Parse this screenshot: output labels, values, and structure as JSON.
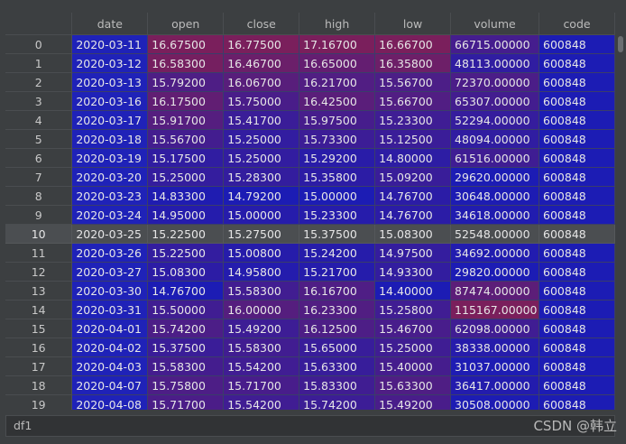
{
  "table": {
    "columns": [
      "",
      "date",
      "open",
      "close",
      "high",
      "low",
      "volume",
      "code"
    ],
    "rows": [
      [
        "0",
        "2020-03-11",
        "16.67500",
        "16.77500",
        "17.16700",
        "16.66700",
        "66715.00000",
        "600848"
      ],
      [
        "1",
        "2020-03-12",
        "16.58300",
        "16.46700",
        "16.65000",
        "16.35800",
        "48113.00000",
        "600848"
      ],
      [
        "2",
        "2020-03-13",
        "15.79200",
        "16.06700",
        "16.21700",
        "15.56700",
        "72370.00000",
        "600848"
      ],
      [
        "3",
        "2020-03-16",
        "16.17500",
        "15.75000",
        "16.42500",
        "15.66700",
        "65307.00000",
        "600848"
      ],
      [
        "4",
        "2020-03-17",
        "15.91700",
        "15.41700",
        "15.97500",
        "15.23300",
        "52294.00000",
        "600848"
      ],
      [
        "5",
        "2020-03-18",
        "15.56700",
        "15.25000",
        "15.73300",
        "15.12500",
        "48094.00000",
        "600848"
      ],
      [
        "6",
        "2020-03-19",
        "15.17500",
        "15.25000",
        "15.29200",
        "14.80000",
        "61516.00000",
        "600848"
      ],
      [
        "7",
        "2020-03-20",
        "15.25000",
        "15.28300",
        "15.35800",
        "15.09200",
        "29620.00000",
        "600848"
      ],
      [
        "8",
        "2020-03-23",
        "14.83300",
        "14.79200",
        "15.00000",
        "14.76700",
        "30648.00000",
        "600848"
      ],
      [
        "9",
        "2020-03-24",
        "14.95000",
        "15.00000",
        "15.23300",
        "14.76700",
        "34618.00000",
        "600848"
      ],
      [
        "10",
        "2020-03-25",
        "15.22500",
        "15.27500",
        "15.37500",
        "15.08300",
        "52548.00000",
        "600848"
      ],
      [
        "11",
        "2020-03-26",
        "15.22500",
        "15.00800",
        "15.24200",
        "14.97500",
        "34692.00000",
        "600848"
      ],
      [
        "12",
        "2020-03-27",
        "15.08300",
        "14.95800",
        "15.21700",
        "14.93300",
        "29820.00000",
        "600848"
      ],
      [
        "13",
        "2020-03-30",
        "14.76700",
        "15.58300",
        "16.16700",
        "14.40000",
        "87474.00000",
        "600848"
      ],
      [
        "14",
        "2020-03-31",
        "15.50000",
        "16.00000",
        "16.23300",
        "15.25800",
        "115167.00000",
        "600848"
      ],
      [
        "15",
        "2020-04-01",
        "15.74200",
        "15.49200",
        "16.12500",
        "15.46700",
        "62098.00000",
        "600848"
      ],
      [
        "16",
        "2020-04-02",
        "15.37500",
        "15.58300",
        "15.65000",
        "15.25000",
        "38338.00000",
        "600848"
      ],
      [
        "17",
        "2020-04-03",
        "15.58300",
        "15.54200",
        "15.63300",
        "15.40000",
        "31037.00000",
        "600848"
      ],
      [
        "18",
        "2020-04-07",
        "15.75800",
        "15.71700",
        "15.83300",
        "15.63300",
        "36417.00000",
        "600848"
      ],
      [
        "19",
        "2020-04-08",
        "15.71700",
        "15.54200",
        "15.74200",
        "15.49200",
        "30508.00000",
        "600848"
      ]
    ],
    "selected_row_index": 10,
    "colors": {
      "low": "#1c1cb4",
      "high": "#7a1f5c",
      "selected": "#4b4e51",
      "header_bg": "#3c3f41"
    }
  },
  "bottom": {
    "dataframe_name": "df1"
  },
  "watermark": "CSDN @韩立"
}
